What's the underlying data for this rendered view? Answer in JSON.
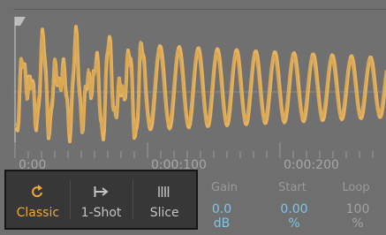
{
  "ruler": {
    "marks": [
      "0:00",
      "0:00:100",
      "0:00:200"
    ]
  },
  "modes": [
    {
      "label": "Classic",
      "icon": "loop-arrow-icon",
      "active": true
    },
    {
      "label": "1-Shot",
      "icon": "arrow-right-bar-icon",
      "active": false
    },
    {
      "label": "Slice",
      "icon": "vertical-bars-icon",
      "active": false
    }
  ],
  "params": {
    "gain": {
      "label": "Gain",
      "value": "0.0 dB"
    },
    "start": {
      "label": "Start",
      "value": "0.00 %"
    },
    "loop": {
      "label": "Loop",
      "value": "100 %"
    }
  },
  "colors": {
    "waveform": "#e6b25f",
    "active_mode": "#f0a838",
    "value_highlight": "#7fc4e6"
  }
}
